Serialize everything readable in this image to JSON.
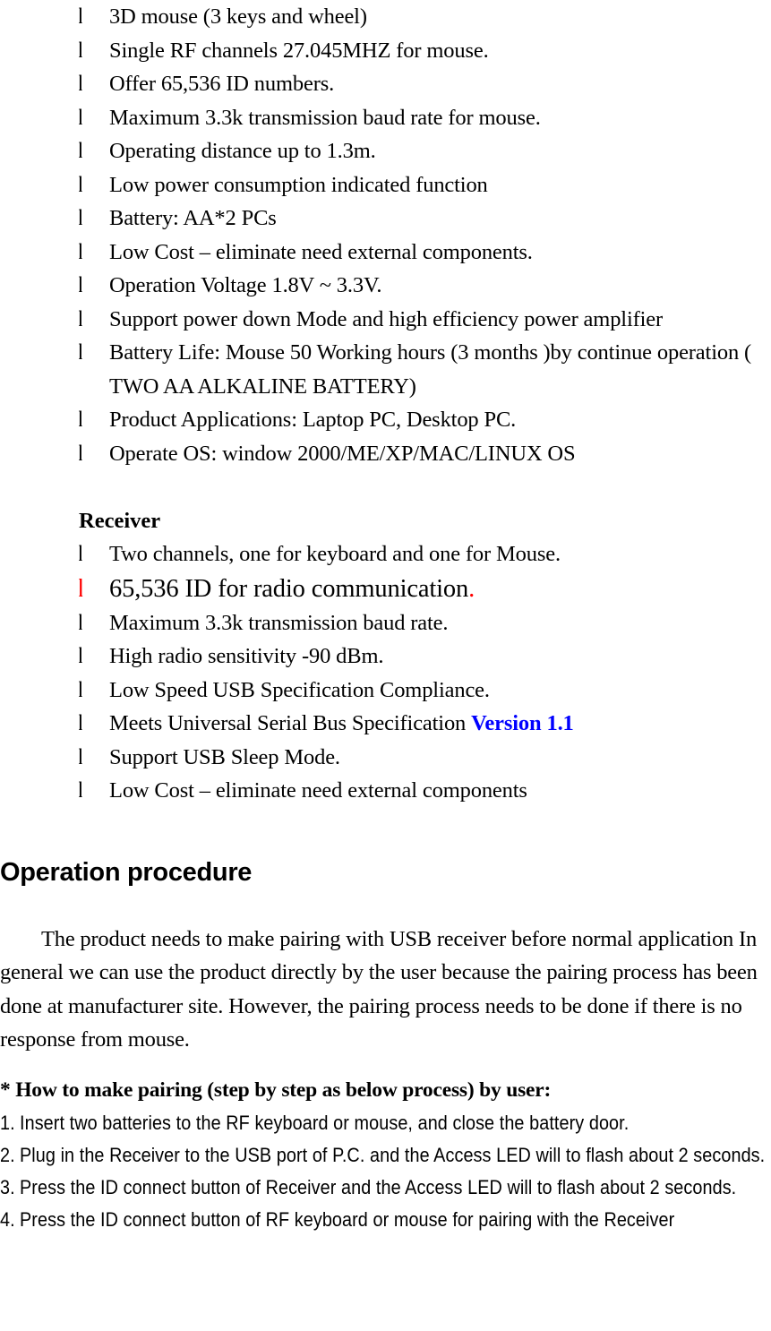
{
  "document": {
    "bullet_glyph": "l",
    "accent_color": "#ff0000",
    "link_color": "#0000ff"
  },
  "mouse_specs": {
    "items": [
      "3D mouse (3 keys and wheel)",
      "Single RF channels 27.045MHZ for mouse.",
      "Offer 65,536 ID numbers.",
      "Maximum 3.3k transmission baud rate for mouse.",
      "Operating distance up to 1.3m.",
      "Low power consumption indicated function",
      "Battery: AA*2 PCs",
      "Low Cost – eliminate need external components.",
      "Operation Voltage 1.8V ~ 3.3V.",
      "Support power down Mode and high efficiency power amplifier",
      "Battery Life: Mouse 50 Working hours (3 months )by continue operation ( TWO AA ALKALINE BATTERY)",
      "Product Applications: Laptop PC, Desktop PC.",
      "Operate OS: window 2000/ME/XP/MAC/LINUX OS"
    ]
  },
  "receiver": {
    "heading": "Receiver",
    "item_1": "Two channels, one for keyboard and one for Mouse.",
    "item_2_text": "65,536 ID for radio communication",
    "item_2_period": ".",
    "item_3": "Maximum 3.3k transmission baud rate.",
    "item_4": "High radio sensitivity -90 dBm.",
    "item_5": "Low Speed USB Specification Compliance.",
    "item_6_prefix": "Meets Universal Serial Bus Specification ",
    "item_6_version": "Version 1.1",
    "item_7": "Support USB Sleep Mode.",
    "item_8": "Low Cost – eliminate need external components"
  },
  "operation": {
    "heading": "Operation procedure",
    "paragraph": "The product needs to make pairing with USB receiver before normal application In general we can use the product directly by the user because the pairing process has been done at manufacturer site. However, the pairing process needs to be done if there is no response from mouse.",
    "callout": "* How to make pairing (step by step as below process) by user:",
    "steps": [
      {
        "num": "1.",
        "text": "Insert two batteries to the RF keyboard or mouse, and close the battery door."
      },
      {
        "num": "2.",
        "text": "Plug in the Receiver to the USB port of P.C. and the Access LED will to flash about 2 seconds."
      },
      {
        "num": "3.",
        "text": "Press the ID connect button of Receiver and the Access LED will to flash about 2 seconds."
      },
      {
        "num": "4.",
        "text": "Press the ID connect button of RF keyboard or mouse for pairing with the Receiver"
      }
    ]
  }
}
